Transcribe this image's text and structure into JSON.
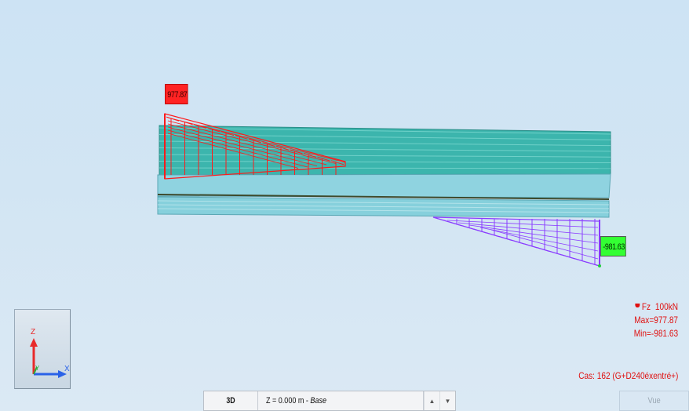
{
  "viewport": {
    "max_value_label": "977.87",
    "min_value_label": "-981.63",
    "colors": {
      "beam": "#8fd3e0",
      "beam_top": "#3cb5ad",
      "positive_diagram": "#ff1a1a",
      "negative_diagram": "#8a3cff",
      "max_label_bg": "#ff2323",
      "min_label_bg": "#33ff33"
    }
  },
  "legend": {
    "component": "Fz",
    "unit_scale": "100kN",
    "max": "Max=977.87",
    "min": "Min=-981.63",
    "case": "Cas: 162 (G+D240éxentré+)",
    "icon": "force-diagram-icon"
  },
  "axis_widget": {
    "z_label": "Z",
    "y_label": "Y",
    "x_label": "X",
    "z_color": "#e82a2a",
    "x_color": "#2a62e8",
    "y_color": "#2fae3c"
  },
  "bottom_bar": {
    "view_mode": "3D",
    "plane_value": "Z = 0.000 m",
    "plane_separator": " - ",
    "plane_name": "Base",
    "spin_up": "▲",
    "spin_down": "▼"
  },
  "view_button": {
    "label": "Vue"
  }
}
